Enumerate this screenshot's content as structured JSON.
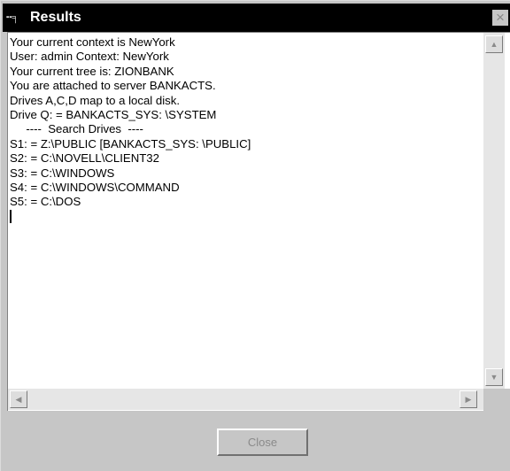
{
  "window": {
    "title": "Results",
    "icon": "netware-icon",
    "close_glyph": "×"
  },
  "output_lines": [
    "Your current context is NewYork",
    "User: admin Context: NewYork",
    "Your current tree is: ZIONBANK",
    "You are attached to server BANKACTS.",
    "Drives A,C,D map to a local disk.",
    "Drive Q: = BANKACTS_SYS: \\SYSTEM",
    "     ----  Search Drives  ----",
    "S1: = Z:\\PUBLIC [BANKACTS_SYS: \\PUBLIC]",
    "S2: = C:\\NOVELL\\CLIENT32",
    "S3: = C:\\WINDOWS",
    "S4: = C:\\WINDOWS\\COMMAND",
    "S5: = C:\\DOS"
  ],
  "scrollbar_glyphs": {
    "up": "▲",
    "down": "▼",
    "left": "◀",
    "right": "▶"
  },
  "buttons": {
    "close_label": "Close",
    "close_enabled": false
  }
}
